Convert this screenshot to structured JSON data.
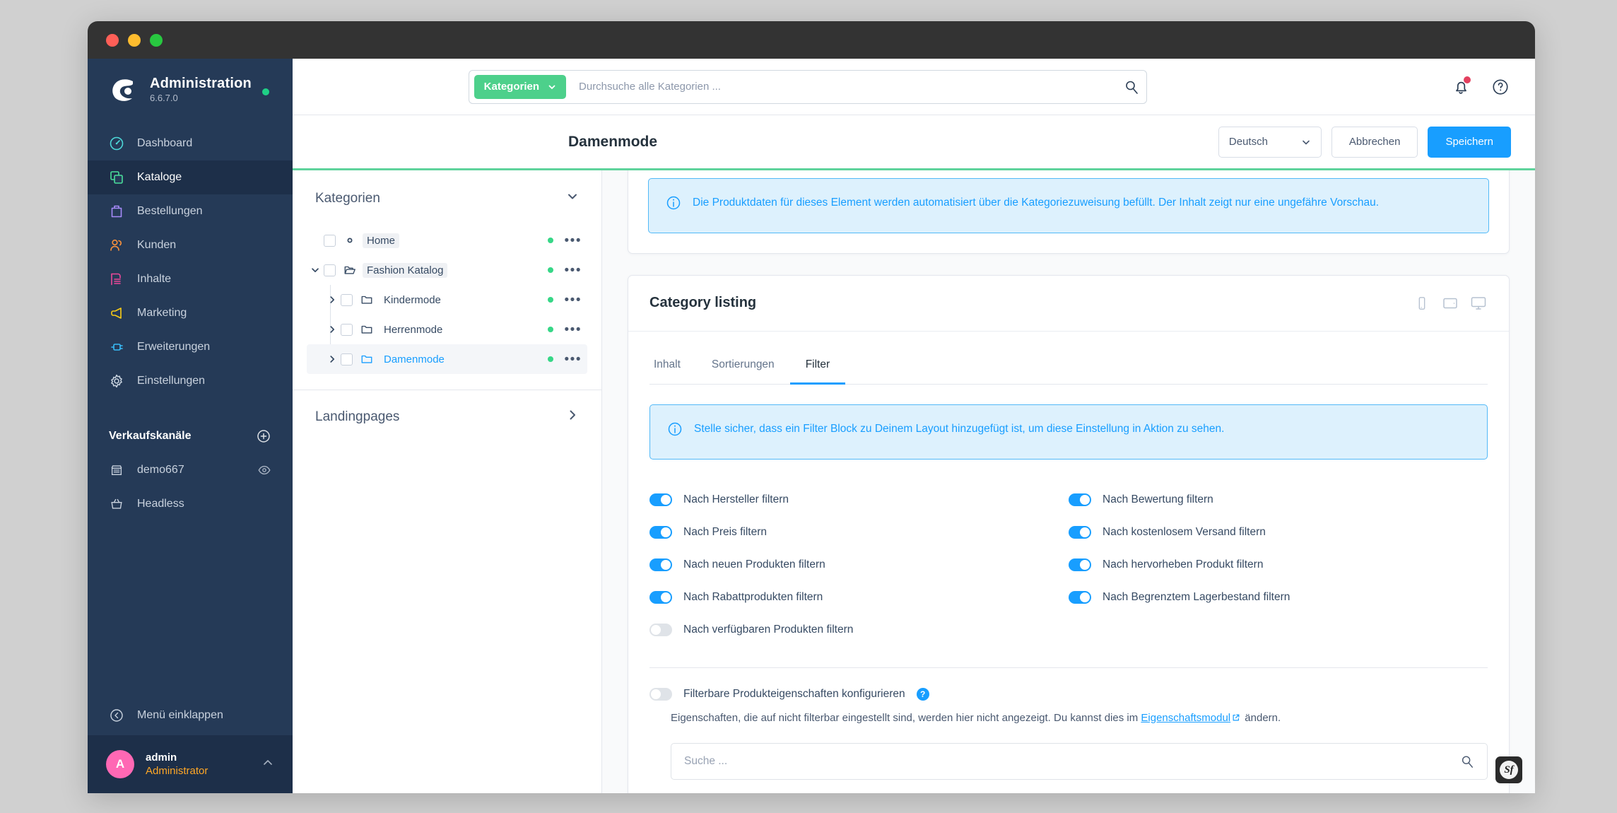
{
  "window": {
    "traffic_lights": [
      "close",
      "minimize",
      "maximize"
    ]
  },
  "sidebar": {
    "brand": {
      "title": "Administration",
      "version": "6.6.7.0",
      "status_dot_color": "#1fd086"
    },
    "items": [
      {
        "label": "Dashboard",
        "icon": "dashboard-icon",
        "color": "#4dd8d8",
        "active": false
      },
      {
        "label": "Kataloge",
        "icon": "catalog-icon",
        "color": "#4ade9b",
        "active": true
      },
      {
        "label": "Bestellungen",
        "icon": "orders-icon",
        "color": "#a78bfa",
        "active": false
      },
      {
        "label": "Kunden",
        "icon": "customers-icon",
        "color": "#fb923c",
        "active": false
      },
      {
        "label": "Inhalte",
        "icon": "content-icon",
        "color": "#ec4899",
        "active": false
      },
      {
        "label": "Marketing",
        "icon": "marketing-icon",
        "color": "#facc15",
        "active": false
      },
      {
        "label": "Erweiterungen",
        "icon": "extensions-icon",
        "color": "#38bdf8",
        "active": false
      },
      {
        "label": "Einstellungen",
        "icon": "settings-gear-icon",
        "color": "#cbd5e1",
        "active": false
      }
    ],
    "sales_channels": {
      "title": "Verkaufskanäle",
      "add_label": "+",
      "channels": [
        {
          "label": "demo667",
          "icon": "storefront-icon",
          "has_preview": true
        },
        {
          "label": "Headless",
          "icon": "basket-icon",
          "has_preview": false
        }
      ]
    },
    "collapse_label": "Menü einklappen",
    "user": {
      "initial": "A",
      "name": "admin",
      "role": "Administrator"
    }
  },
  "topbar": {
    "search_scope": "Kategorien",
    "search_placeholder": "Durchsuche alle Kategorien ...",
    "search_value": "",
    "notifications_icon": "bell-icon",
    "has_notification": true,
    "help_icon": "question-circle-icon"
  },
  "pagehead": {
    "title": "Damenmode",
    "language": "Deutsch",
    "cancel_label": "Abbrechen",
    "save_label": "Speichern",
    "accent_color": "#5fd39c"
  },
  "tree_panel": {
    "header": "Kategorien",
    "nodes": [
      {
        "label": "Home",
        "icon": "dot-icon",
        "depth": 0,
        "caret": "none",
        "highlight": true,
        "selected": false,
        "active": false,
        "status": "active"
      },
      {
        "label": "Fashion Katalog",
        "icon": "folder-open-icon",
        "depth": 0,
        "caret": "down",
        "highlight": true,
        "selected": false,
        "active": false,
        "status": "active"
      },
      {
        "label": "Kindermode",
        "icon": "folder-icon",
        "depth": 1,
        "caret": "right",
        "highlight": false,
        "selected": false,
        "active": false,
        "status": "active"
      },
      {
        "label": "Herrenmode",
        "icon": "folder-icon",
        "depth": 1,
        "caret": "right",
        "highlight": false,
        "selected": false,
        "active": false,
        "status": "active"
      },
      {
        "label": "Damenmode",
        "icon": "folder-icon",
        "depth": 1,
        "caret": "right",
        "highlight": false,
        "selected": true,
        "active": true,
        "status": "active"
      }
    ],
    "landingpages_label": "Landingpages"
  },
  "main": {
    "top_alert": "Die Produktdaten für dieses Element werden automatisiert über die Kategoriezuweisung befüllt. Der Inhalt zeigt nur eine ungefähre Vorschau.",
    "card": {
      "title": "Category listing",
      "devices": [
        "mobile-icon",
        "tablet-icon",
        "desktop-icon"
      ],
      "tabs": [
        {
          "label": "Inhalt",
          "active": false
        },
        {
          "label": "Sortierungen",
          "active": false
        },
        {
          "label": "Filter",
          "active": true
        }
      ],
      "filter_alert": "Stelle sicher, dass ein Filter Block zu Deinem Layout hinzugefügt ist, um diese Einstellung in Aktion zu sehen.",
      "toggles": [
        {
          "label": "Nach Hersteller filtern",
          "on": true,
          "column": "left"
        },
        {
          "label": "Nach Bewertung filtern",
          "on": true,
          "column": "right"
        },
        {
          "label": "Nach Preis filtern",
          "on": true,
          "column": "left"
        },
        {
          "label": "Nach kostenlosem Versand filtern",
          "on": true,
          "column": "right"
        },
        {
          "label": "Nach neuen Produkten filtern",
          "on": true,
          "column": "left"
        },
        {
          "label": "Nach hervorheben Produkt filtern",
          "on": true,
          "column": "right"
        },
        {
          "label": "Nach Rabattprodukten filtern",
          "on": true,
          "column": "left"
        },
        {
          "label": "Nach Begrenztem Lagerbestand filtern",
          "on": true,
          "column": "right"
        },
        {
          "label": "Nach verfügbaren Produkten filtern",
          "on": false,
          "column": "left"
        }
      ],
      "properties": {
        "toggle_label": "Filterbare Produkteigenschaften konfigurieren",
        "toggle_on": false,
        "help_glyph": "?",
        "hint_before": "Eigenschaften, die auf nicht filterbar eingestellt sind, werden hier nicht angezeigt. Du kannst dies im ",
        "hint_link": "Eigenschaftsmodul",
        "hint_after": " ändern.",
        "search_placeholder": "Suche ...",
        "search_value": ""
      }
    }
  },
  "debug_toolbar": {
    "label": "Sf",
    "icon": "symfony-icon"
  }
}
